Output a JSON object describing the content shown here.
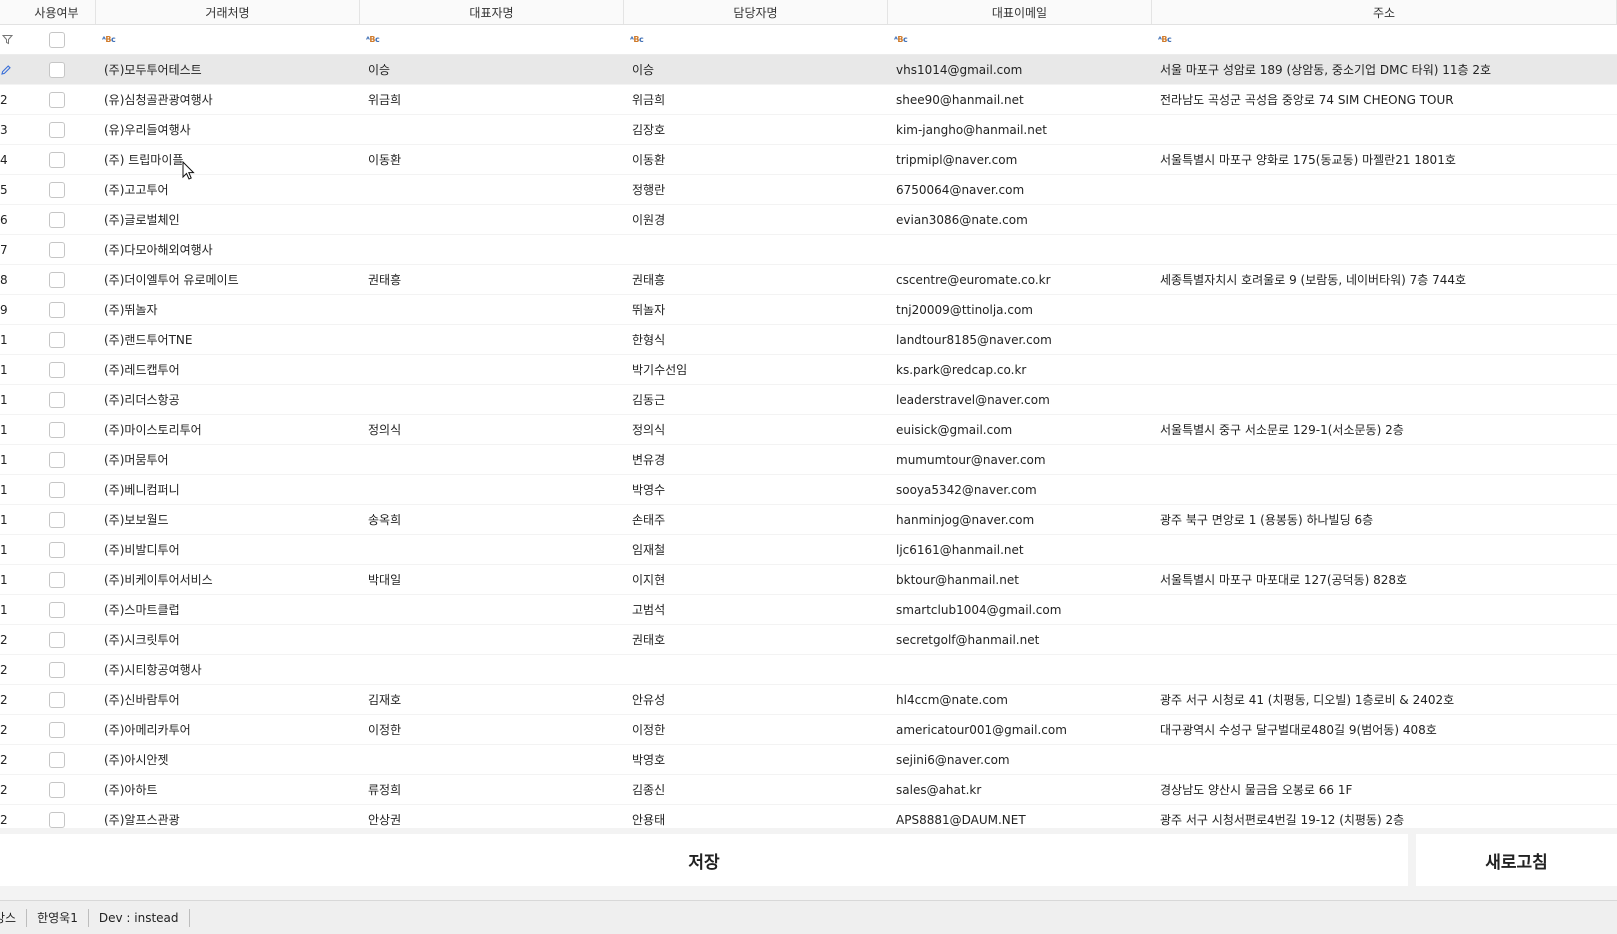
{
  "columns": [
    "사용여부",
    "거래처명",
    "대표자명",
    "담당자명",
    "대표이메일",
    "주소"
  ],
  "filter_icon": "filter-icon",
  "filter_text_icon": "abc-text-filter-icon",
  "colors": {
    "selected_row": "#e8e8e8",
    "header_bg": "#fafafa",
    "edit_icon": "#3a6fd8",
    "footer_bg": "#f3f3f3"
  },
  "rows": [
    {
      "num": "",
      "vendor": "(주)모두투어테스트",
      "rep": "이승",
      "manager": "이승",
      "email": "vhs1014@gmail.com",
      "address": "서울 마포구 성암로 189 (상암동, 중소기업 DMC 타워) 11층 2호"
    },
    {
      "num": "2",
      "vendor": "(유)심청골관광여행사",
      "rep": "위금희",
      "manager": "위금희",
      "email": "shee90@hanmail.net",
      "address": "전라남도 곡성군 곡성읍 중앙로 74 SIM CHEONG TOUR"
    },
    {
      "num": "3",
      "vendor": "(유)우리들여행사",
      "rep": "",
      "manager": "김장호",
      "email": "kim-jangho@hanmail.net",
      "address": ""
    },
    {
      "num": "4",
      "vendor": "(주) 트립마이플",
      "rep": "이동환",
      "manager": "이동환",
      "email": "tripmipl@naver.com",
      "address": "서울특별시 마포구 양화로 175(동교동) 마젤란21 1801호"
    },
    {
      "num": "5",
      "vendor": "(주)고고투어",
      "rep": "",
      "manager": "정행란",
      "email": "6750064@naver.com",
      "address": ""
    },
    {
      "num": "6",
      "vendor": "(주)글로벌체인",
      "rep": "",
      "manager": "이원경",
      "email": "evian3086@nate.com",
      "address": ""
    },
    {
      "num": "7",
      "vendor": "(주)다모아해외여행사",
      "rep": "",
      "manager": "",
      "email": "",
      "address": ""
    },
    {
      "num": "8",
      "vendor": "(주)더이엘투어 유로메이트",
      "rep": "권태흥",
      "manager": "권태흥",
      "email": "cscentre@euromate.co.kr",
      "address": "세종특별자치시 호려울로 9 (보람동, 네이버타워) 7층 744호"
    },
    {
      "num": "9",
      "vendor": "(주)뛰놀자",
      "rep": "",
      "manager": "뛰놀자",
      "email": "tnj20009@ttinolja.com",
      "address": ""
    },
    {
      "num": "1",
      "vendor": "(주)랜드투어TNE",
      "rep": "",
      "manager": "한형식",
      "email": "landtour8185@naver.com",
      "address": ""
    },
    {
      "num": "1",
      "vendor": "(주)레드캡투어",
      "rep": "",
      "manager": "박기수선임",
      "email": "ks.park@redcap.co.kr",
      "address": ""
    },
    {
      "num": "1",
      "vendor": "(주)리더스항공",
      "rep": "",
      "manager": "김동근",
      "email": "leaderstravel@naver.com",
      "address": ""
    },
    {
      "num": "1",
      "vendor": "(주)마이스토리투어",
      "rep": "정의식",
      "manager": "정의식",
      "email": "euisick@gmail.com",
      "address": "서울특별시 중구 서소문로 129-1(서소문동) 2층"
    },
    {
      "num": "1",
      "vendor": "(주)머뭄투어",
      "rep": "",
      "manager": "변유경",
      "email": "mumumtour@naver.com",
      "address": ""
    },
    {
      "num": "1",
      "vendor": "(주)베니컴퍼니",
      "rep": "",
      "manager": "박영수",
      "email": "sooya5342@naver.com",
      "address": ""
    },
    {
      "num": "1",
      "vendor": "(주)보보월드",
      "rep": "송옥희",
      "manager": "손태주",
      "email": "hanminjog@naver.com",
      "address": "광주 북구 면앙로 1 (용봉동) 하나빌딩 6층"
    },
    {
      "num": "1",
      "vendor": "(주)비발디투어",
      "rep": "",
      "manager": "임재철",
      "email": "ljc6161@hanmail.net",
      "address": ""
    },
    {
      "num": "1",
      "vendor": "(주)비케이투어서비스",
      "rep": "박대일",
      "manager": "이지현",
      "email": "bktour@hanmail.net",
      "address": "서울특별시 마포구 마포대로 127(공덕동) 828호"
    },
    {
      "num": "1",
      "vendor": "(주)스마트클럽",
      "rep": "",
      "manager": "고범석",
      "email": "smartclub1004@gmail.com",
      "address": ""
    },
    {
      "num": "2",
      "vendor": "(주)시크릿투어",
      "rep": "",
      "manager": "권태호",
      "email": "secretgolf@hanmail.net",
      "address": ""
    },
    {
      "num": "2",
      "vendor": "(주)시티항공여행사",
      "rep": "",
      "manager": "",
      "email": "",
      "address": ""
    },
    {
      "num": "2",
      "vendor": "(주)신바람투어",
      "rep": "김재호",
      "manager": "안유성",
      "email": "hl4ccm@nate.com",
      "address": "광주 서구 시청로 41 (치평동, 디오빌) 1층로비 & 2402호"
    },
    {
      "num": "2",
      "vendor": "(주)아메리카투어",
      "rep": "이정한",
      "manager": "이정한",
      "email": "americatour001@gmail.com",
      "address": "대구광역시 수성구 달구벌대로480길 9(범어동) 408호"
    },
    {
      "num": "2",
      "vendor": "(주)아시안젯",
      "rep": "",
      "manager": "박영호",
      "email": "sejini6@naver.com",
      "address": ""
    },
    {
      "num": "2",
      "vendor": "(주)아하트",
      "rep": "류정희",
      "manager": "김종신",
      "email": "sales@ahat.kr",
      "address": "경상남도 양산시 물금읍 오봉로 66 1F"
    },
    {
      "num": "2",
      "vendor": "(주)알프스관광",
      "rep": "안상권",
      "manager": "안용태",
      "email": "APS8881@DAUM.NET",
      "address": "광주 서구 시청서편로4번길 19-12 (치평동) 2층"
    }
  ],
  "buttons": {
    "save": "저장",
    "refresh": "새로고침"
  },
  "status_bar": [
    "강스",
    "한영욱1",
    "Dev : instead"
  ]
}
